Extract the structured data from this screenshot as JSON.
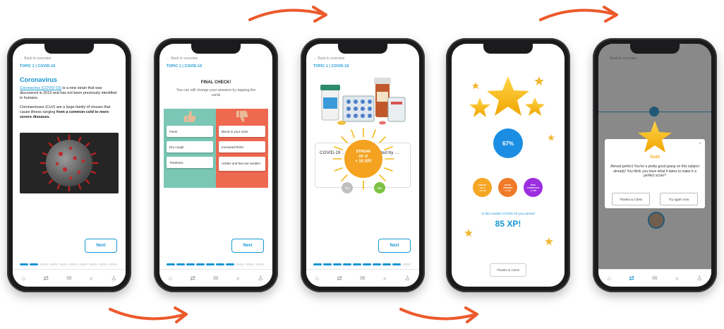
{
  "colors": {
    "accent": "#1796d3",
    "arrow": "#ec5a2c"
  },
  "icons": {
    "navbar": [
      "home-icon",
      "modules-icon",
      "mail-icon",
      "search-icon",
      "profile-icon"
    ]
  },
  "common": {
    "back": "Back to overview",
    "topic": "TOPIC 1 | COVID-19",
    "next": "Next"
  },
  "phone1": {
    "title": "Coronavirus",
    "link": "Coronavirus (COVID-19)",
    "para1_rest": " is a new strain that was discovered in 2019 and has not been previously identified in humans.",
    "para2_plain": "Coronaviruses (CoV) are a large family of viruses that cause illness ranging ",
    "para2_bold": "from a common cold to more severe diseases."
  },
  "phone2": {
    "title": "FINAL CHECK!",
    "subtitle": "You can still change your answers by tapping the cards",
    "left_cards": [
      "Fever",
      "Dry cough",
      "Tiredness"
    ],
    "right_cards": [
      "Blood in your urine",
      "Increased thirst",
      "Ankles and feet are swollen"
    ]
  },
  "phone3": {
    "card_text": "COVID-19 … person to … treated by …",
    "streak_line1": "STREAK",
    "streak_line2": "OF 3!",
    "streak_xp": "+ 10 XP!",
    "you_label": "You",
    "me_label": "Me"
  },
  "phone4": {
    "percent": "67%",
    "badges": [
      {
        "line1": "STREAK",
        "line2": "OF 3",
        "xp": "+ 10 XP",
        "color": "#f5a623"
      },
      {
        "line1": "QUICK",
        "line2": "ANSWER",
        "xp": "+ 5 XP",
        "color": "#f07a2a"
      },
      {
        "line1": "NICE",
        "line2": "COMEBACK",
        "xp": "+ 5 XP",
        "color": "#9b2fe0"
      }
    ],
    "earned": "In this module COVID-19 you earned",
    "xp": "85 XP!",
    "button": "Thanks & Close"
  },
  "phone5": {
    "gold": "Gold",
    "message": "Almost perfect You've a pretty good grasp on this subject already! You think you have what it takes to make it a perfect score?",
    "btn_close": "Thanks & Close",
    "btn_try": "Try again now"
  }
}
